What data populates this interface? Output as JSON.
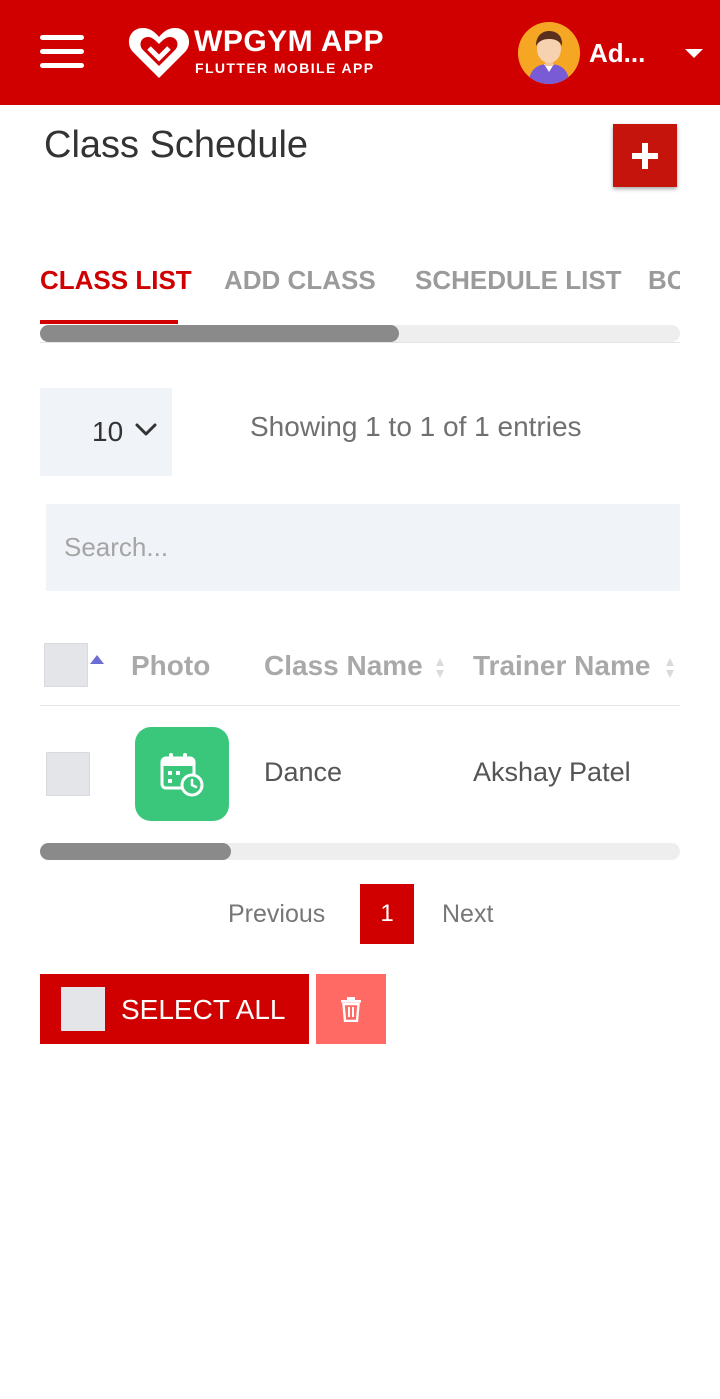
{
  "header": {
    "logo_title": "WPGYM APP",
    "logo_subtitle": "FLUTTER MOBILE APP",
    "user_name": "Ad...",
    "brand_color": "#d10000"
  },
  "page": {
    "title": "Class Schedule"
  },
  "tabs": [
    {
      "label": "CLASS LIST",
      "active": true
    },
    {
      "label": "ADD CLASS",
      "active": false
    },
    {
      "label": "SCHEDULE LIST",
      "active": false
    },
    {
      "label": "BC",
      "active": false
    }
  ],
  "entries": {
    "page_length": "10",
    "info": "Showing 1 to 1 of 1 entries"
  },
  "search": {
    "placeholder": "Search..."
  },
  "table": {
    "columns": [
      "Photo",
      "Class Name",
      "Trainer Name"
    ],
    "rows": [
      {
        "photo_icon": "calendar-clock-icon",
        "class_name": "Dance",
        "trainer_name": "Akshay Patel"
      }
    ]
  },
  "pagination": {
    "previous": "Previous",
    "current_page": "1",
    "next": "Next"
  },
  "bulk": {
    "select_all": "SELECT ALL",
    "delete_icon": "trash-icon"
  },
  "colors": {
    "accent": "#d10000",
    "photo_bg": "#3bc77b",
    "delete_bg": "#ff6b64"
  }
}
